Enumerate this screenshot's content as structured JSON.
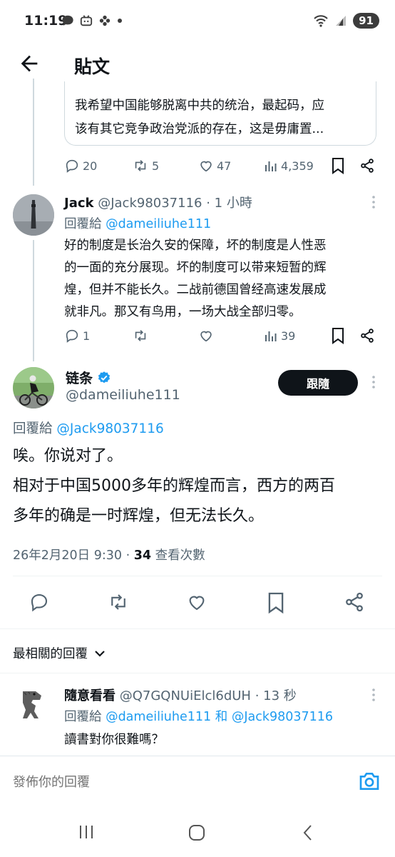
{
  "status_bar": {
    "time": "11:19",
    "battery": "91"
  },
  "header": {
    "title": "貼文"
  },
  "quoted_tweet": {
    "line1": "我希望中国能够脱离中共的统治，最起码，应",
    "line2": "该有其它竞争政治党派的存在，这是毋庸置..."
  },
  "parent_actions": {
    "replies": "20",
    "retweets": "5",
    "likes": "47",
    "views": "4,359"
  },
  "jack_reply": {
    "name": "Jack",
    "handle_time": "@Jack98037116 · 1 小時",
    "reply_prefix": "回覆給",
    "reply_to": "@dameiliuhe111",
    "lines": [
      "好的制度是长治久安的保障，坏的制度是人性恶",
      "的一面的充分展现。坏的制度可以带来短暂的辉",
      "煌，但并不能长久。二战前德国曾经高速发展成",
      "就非凡。那又有鸟用，一场大战全部归零。"
    ],
    "replies": "1",
    "views": "39"
  },
  "main_tweet": {
    "name": "链条",
    "handle": "@dameiliuhe111",
    "follow_label": "跟隨",
    "reply_prefix": "回覆給",
    "reply_to": "@Jack98037116",
    "line1": "唉。你说对了。",
    "line2": "相对于中国5000多年的辉煌而言，西方的两百",
    "line3": "多年的确是一时辉煌，但无法长久。",
    "timestamp": "26年2月20日 9:30 · ",
    "views_count": "34",
    "views_label": " 查看次數"
  },
  "sort": {
    "label": "最相關的回覆"
  },
  "bottom_reply": {
    "name": "隨意看看",
    "handle_time": "@Q7GQNUiElcl6dUH · 13 秒",
    "reply_prefix": "回覆給",
    "reply_to_1": "@dameiliuhe111",
    "reply_and": " 和 ",
    "reply_to_2": "@Jack98037116",
    "text": "讀書對你很難嗎？"
  },
  "compose": {
    "placeholder": "發佈你的回覆"
  },
  "colors": {
    "accent": "#1d9bf0",
    "text": "#0f1419",
    "secondary": "#536471",
    "border": "#cfd9de"
  }
}
